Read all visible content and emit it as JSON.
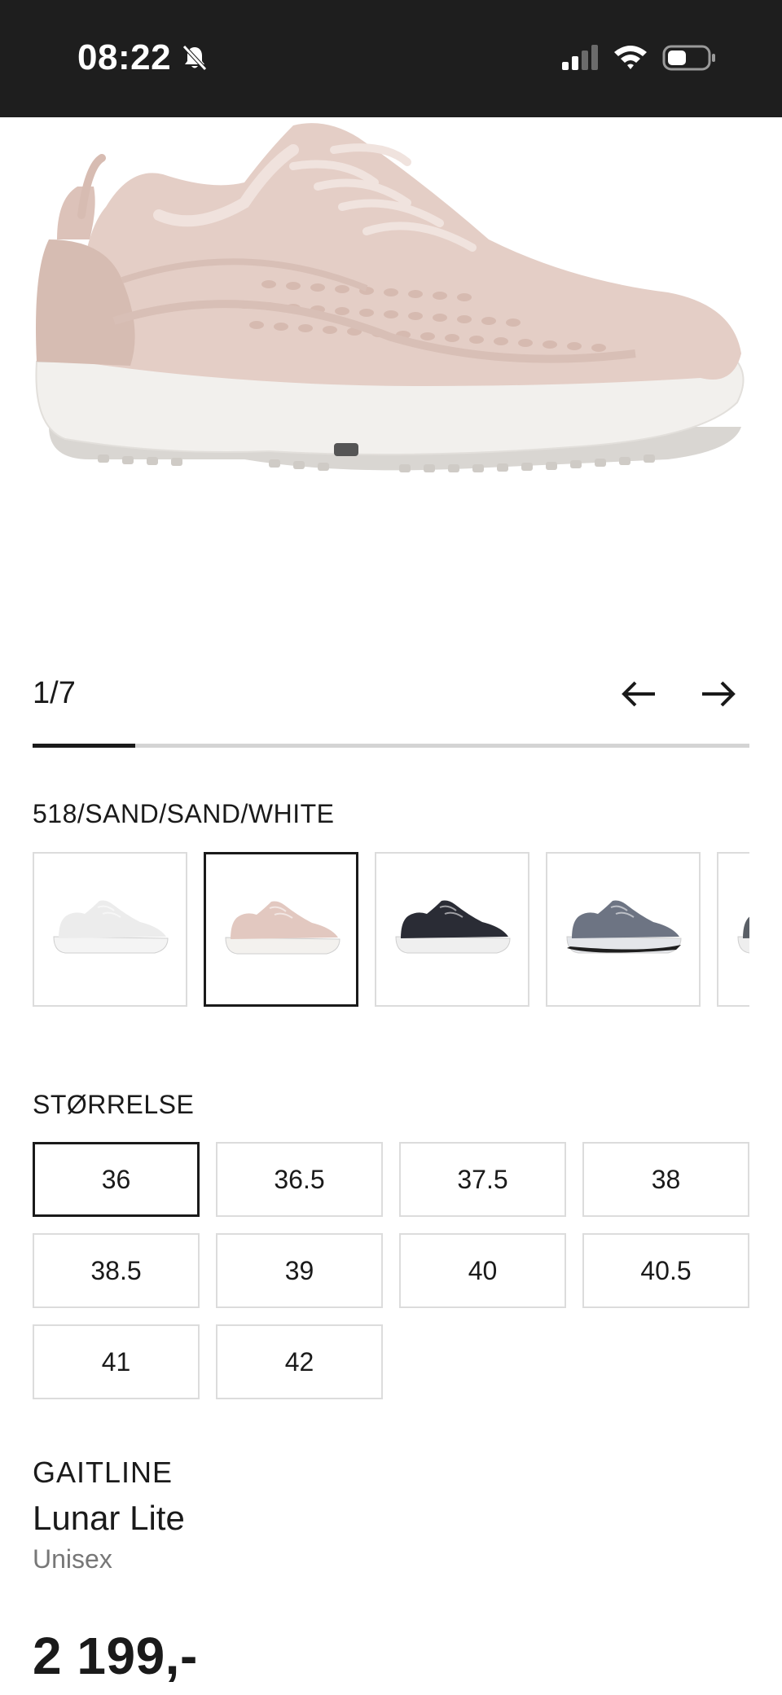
{
  "status_bar": {
    "time": "08:22",
    "icons": [
      "bell-slash-icon",
      "cellular-signal-icon",
      "wifi-icon",
      "battery-icon"
    ]
  },
  "gallery": {
    "counter": "1/7",
    "current": 1,
    "total": 7,
    "prev_icon": "arrow-left-icon",
    "next_icon": "arrow-right-icon"
  },
  "variant": {
    "selected_color_label": "518/SAND/SAND/WHITE",
    "swatches": [
      {
        "name": "white",
        "selected": false,
        "upper": "#ececec",
        "sole": "#f4f4f4"
      },
      {
        "name": "sand",
        "selected": true,
        "upper": "#e2c8c0",
        "sole": "#f3f1ee"
      },
      {
        "name": "black",
        "selected": false,
        "upper": "#2a2c35",
        "sole": "#efefef"
      },
      {
        "name": "grey-blue",
        "selected": false,
        "upper": "#6d7483",
        "sole": "#e4e6ea"
      },
      {
        "name": "dark-grey",
        "selected": false,
        "upper": "#5a5f66",
        "sole": "#eeeeee"
      }
    ]
  },
  "sizes": {
    "label": "STØRRELSE",
    "options": [
      "36",
      "36.5",
      "37.5",
      "38",
      "38.5",
      "39",
      "40",
      "40.5",
      "41",
      "42"
    ],
    "selected": "36"
  },
  "product": {
    "brand": "GAITLINE",
    "name": "Lunar Lite",
    "gender": "Unisex",
    "price": "2 199,-"
  }
}
